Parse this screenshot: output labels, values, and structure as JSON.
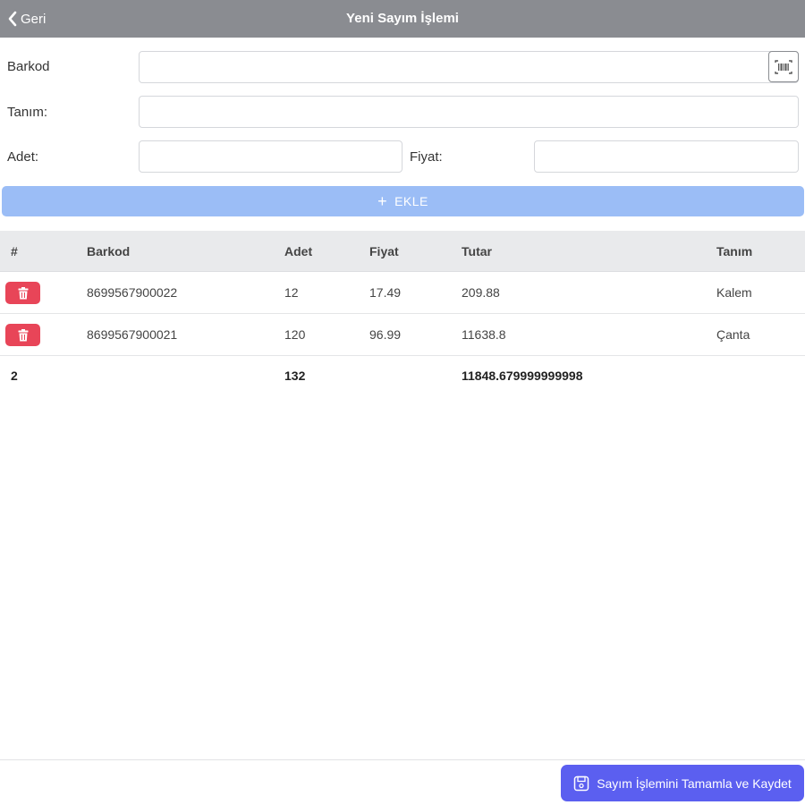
{
  "header": {
    "back_label": "Geri",
    "title": "Yeni Sayım İşlemi",
    "bg_color": "#8a8c91"
  },
  "form": {
    "barkod_label": "Barkod",
    "barkod_value": "",
    "tanim_label": "Tanım:",
    "tanim_value": "",
    "adet_label": "Adet:",
    "adet_value": "",
    "fiyat_label": "Fiyat:",
    "fiyat_value": "",
    "scan_icon": "barcode-scan-icon",
    "add_label": "EKLE",
    "add_color": "#9bbdf6"
  },
  "table": {
    "headers": [
      "#",
      "Barkod",
      "Adet",
      "Fiyat",
      "Tutar",
      "Tanım"
    ],
    "rows": [
      {
        "barkod": "8699567900022",
        "adet": "12",
        "fiyat": "17.49",
        "tutar": "209.88",
        "tanim": "Kalem"
      },
      {
        "barkod": "8699567900021",
        "adet": "120",
        "fiyat": "96.99",
        "tutar": "11638.8",
        "tanim": "Çanta"
      }
    ],
    "totals": {
      "count": "2",
      "adet": "132",
      "tutar": "11848.679999999998"
    },
    "delete_icon": "trash-icon",
    "delete_color": "#e84558"
  },
  "footer": {
    "save_label": "Sayım İşlemini Tamamla ve Kaydet",
    "save_icon": "save-icon",
    "save_color": "#5b5ff0"
  }
}
